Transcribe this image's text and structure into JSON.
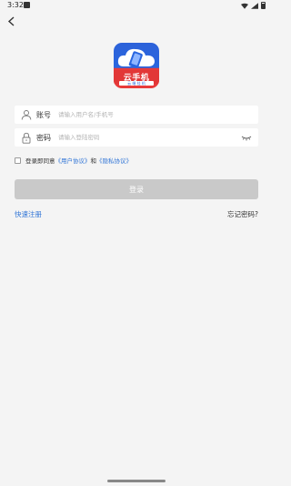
{
  "status": {
    "time": "3:32"
  },
  "logo": {
    "title": "云手机",
    "subtitle": "云 端 挂 机"
  },
  "account": {
    "label": "账号",
    "placeholder": "请输入用户名/手机号"
  },
  "password": {
    "label": "密码",
    "placeholder": "请输入登陆密码"
  },
  "agreement": {
    "prefix": "登录即同意",
    "user_agreement": "《用户协议》",
    "and": "和",
    "privacy_policy": "《隐私协议》"
  },
  "login_button": "登录",
  "register": "快速注册",
  "forgot_password": "忘记密码?",
  "colors": {
    "accent_link": "#2f74d6",
    "button_disabled": "#c9c9c9",
    "background": "#f4f4f4"
  },
  "icons": [
    "back-icon",
    "user-icon",
    "lock-icon",
    "eye-closed-icon"
  ]
}
